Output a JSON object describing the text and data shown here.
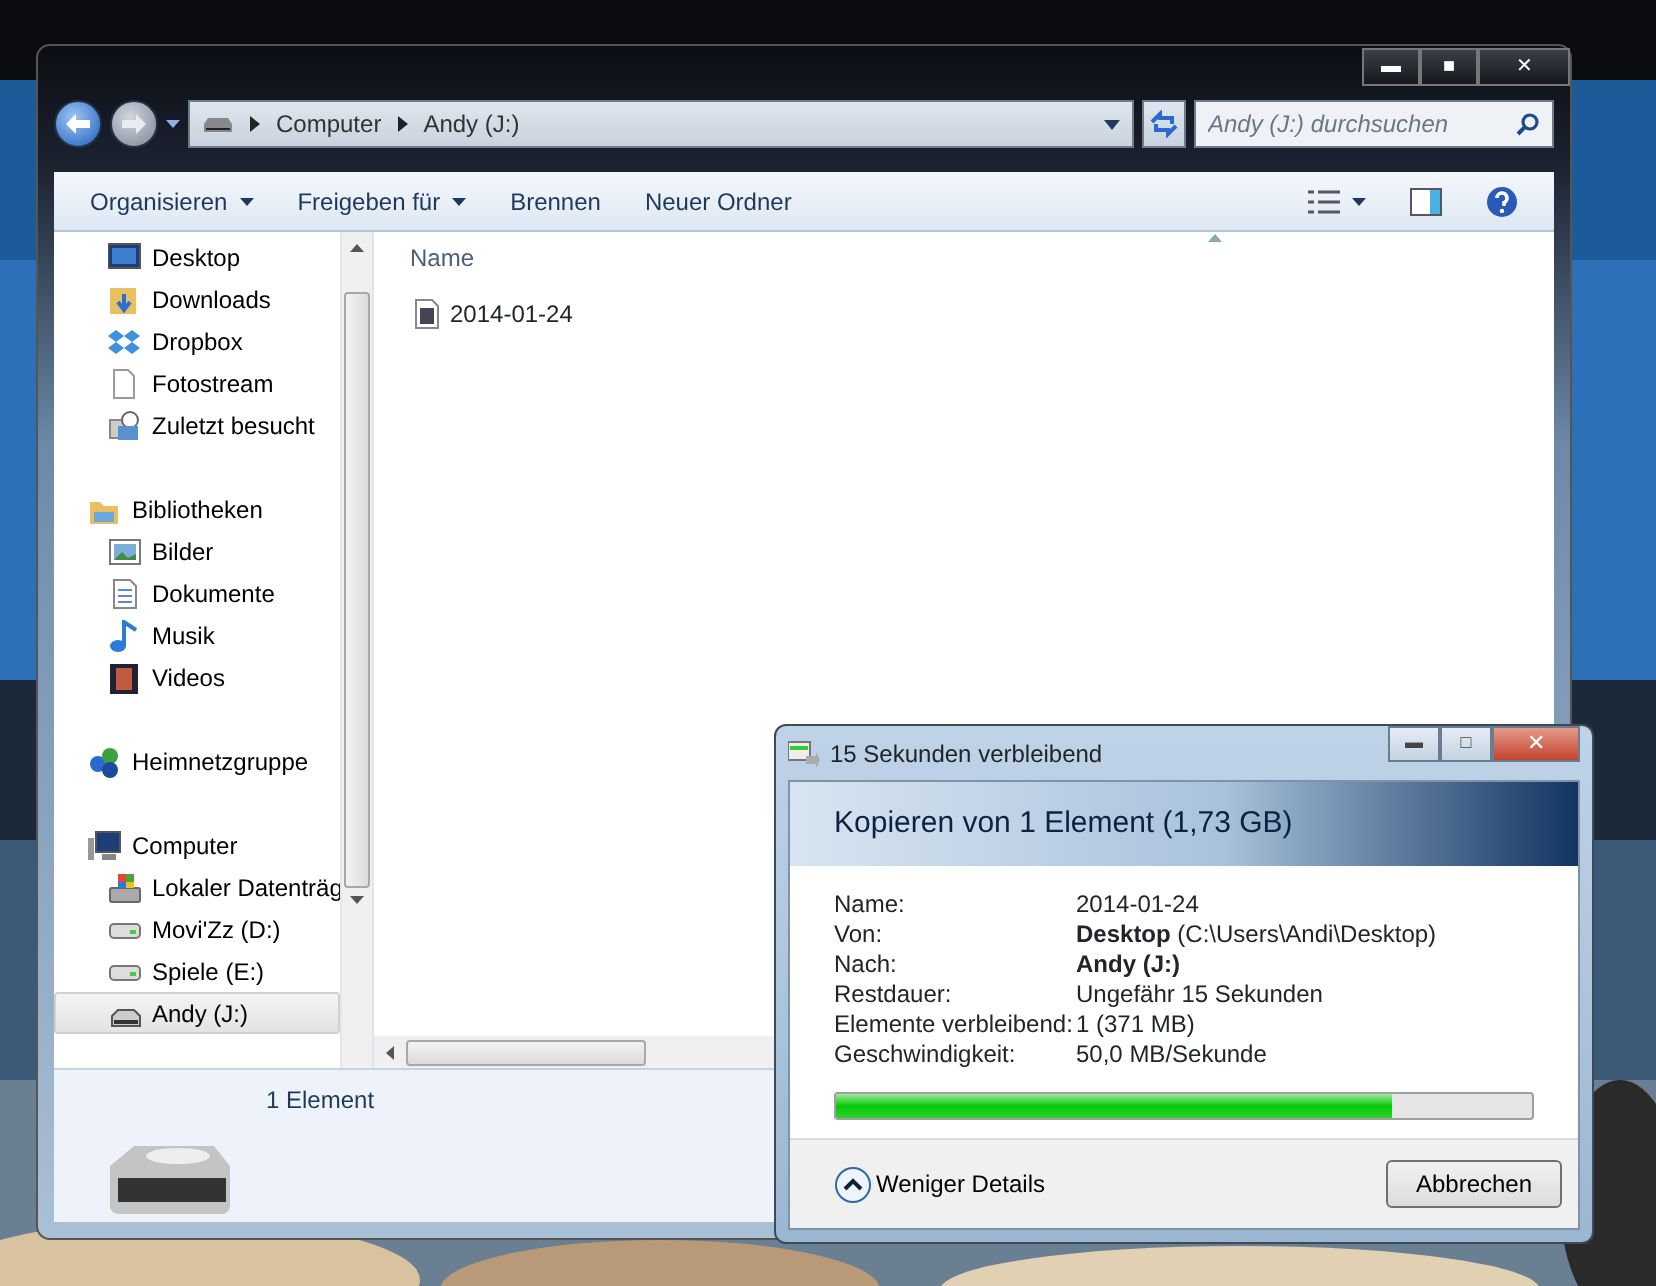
{
  "explorer": {
    "window_buttons": [
      "▬",
      "■",
      "✕"
    ],
    "breadcrumb": [
      "Computer",
      "Andy (J:)"
    ],
    "search": {
      "placeholder": "Andy (J:) durchsuchen"
    },
    "toolbar": [
      {
        "label": "Organisieren",
        "dropdown": true
      },
      {
        "label": "Freigeben für",
        "dropdown": true
      },
      {
        "label": "Brennen",
        "dropdown": false
      },
      {
        "label": "Neuer Ordner",
        "dropdown": false
      }
    ],
    "nav_groups": [
      {
        "children": [
          {
            "label": "Desktop",
            "kind": "desktop",
            "selected": false
          },
          {
            "label": "Downloads",
            "kind": "downloads",
            "selected": false
          },
          {
            "label": "Dropbox",
            "kind": "dropbox",
            "selected": false
          },
          {
            "label": "Fotostream",
            "kind": "page",
            "selected": false
          },
          {
            "label": "Zuletzt besucht",
            "kind": "recent",
            "selected": false
          }
        ]
      },
      {
        "label": "Bibliotheken",
        "kind": "library",
        "selected": false,
        "children": [
          {
            "label": "Bilder",
            "kind": "pictures",
            "selected": false
          },
          {
            "label": "Dokumente",
            "kind": "documents",
            "selected": false
          },
          {
            "label": "Musik",
            "kind": "music",
            "selected": false
          },
          {
            "label": "Videos",
            "kind": "videos",
            "selected": false
          }
        ]
      },
      {
        "label": "Heimnetzgruppe",
        "kind": "homegroup",
        "selected": false
      },
      {
        "label": "Computer",
        "kind": "computer",
        "selected": false,
        "children": [
          {
            "label": "Lokaler Datenträg",
            "kind": "systemdrive",
            "selected": false
          },
          {
            "label": "Movi'Zz (D:)",
            "kind": "drive",
            "selected": false
          },
          {
            "label": "Spiele (E:)",
            "kind": "drive",
            "selected": false
          },
          {
            "label": "Andy (J:)",
            "kind": "removable",
            "selected": true
          }
        ]
      }
    ],
    "columns": [
      "Name"
    ],
    "files": [
      {
        "name": "2014-01-24"
      }
    ],
    "details": {
      "count": "1 Element"
    }
  },
  "copy_dialog": {
    "title": "15 Sekunden verbleibend",
    "window_buttons": [
      "▬",
      "□",
      "✕"
    ],
    "heading": "Kopieren von 1 Element (1,73 GB)",
    "rows": [
      {
        "label": "Name:",
        "value": "2014-01-24",
        "bold": false
      },
      {
        "label": "Von:",
        "value": "**Desktop** (C:\\Users\\Andi\\Desktop)",
        "bold": false
      },
      {
        "label": "Nach:",
        "value": "Andy (J:)",
        "bold": true
      },
      {
        "label": "Restdauer:",
        "value": "Ungefähr 15 Sekunden",
        "bold": false
      },
      {
        "label": "Elemente verbleibend:",
        "value": "1 (371 MB)",
        "bold": false
      },
      {
        "label": "Geschwindigkeit:",
        "value": "50,0 MB/Sekunde",
        "bold": false
      }
    ],
    "progress": {
      "level": 0.8
    },
    "details_toggle": "Weniger Details",
    "cancel": "Abbrechen"
  }
}
